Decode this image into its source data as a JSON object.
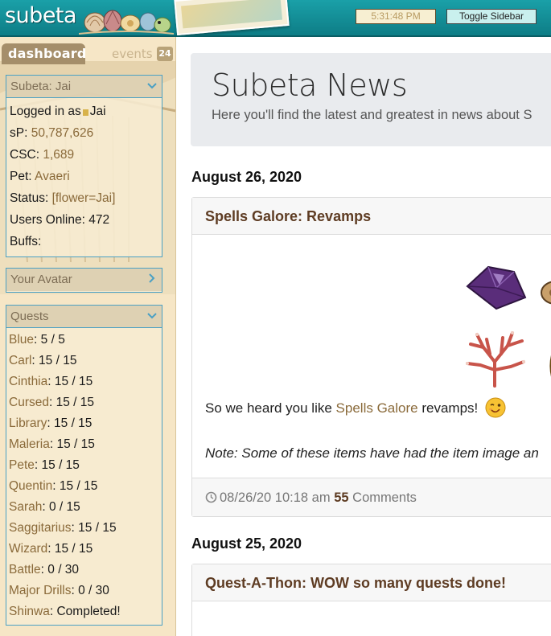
{
  "header": {
    "logo_text": "subeta",
    "clock": "5:31:48 PM",
    "toggle_sidebar_label": "Toggle Sidebar"
  },
  "sidebar": {
    "tabs": {
      "dashboard": "dashboard",
      "events": "events",
      "events_count": "24"
    },
    "user_panel": {
      "title": "Subeta: Jai",
      "logged_in_label": "Logged in as",
      "username": "Jai",
      "sp_label": "sP:",
      "sp_value": "50,787,626",
      "csc_label": "CSC:",
      "csc_value": "1,689",
      "pet_label": "Pet:",
      "pet_value": "Avaeri",
      "status_label": "Status:",
      "status_value": "[flower=Jai]",
      "users_online_label": "Users Online:",
      "users_online_value": "472",
      "buffs_label": "Buffs:"
    },
    "avatar_panel": {
      "title": "Your Avatar"
    },
    "quests_panel": {
      "title": "Quests",
      "items": [
        {
          "name": "Blue",
          "progress": "5 / 5"
        },
        {
          "name": "Carl",
          "progress": "15 / 15"
        },
        {
          "name": "Cinthia",
          "progress": "15 / 15"
        },
        {
          "name": "Cursed",
          "progress": "15 / 15"
        },
        {
          "name": "Library",
          "progress": "15 / 15"
        },
        {
          "name": "Maleria",
          "progress": "15 / 15"
        },
        {
          "name": "Pete",
          "progress": "15 / 15"
        },
        {
          "name": "Quentin",
          "progress": "15 / 15"
        },
        {
          "name": "Sarah",
          "progress": "0 / 15"
        },
        {
          "name": "Saggitarius",
          "progress": "15 / 15"
        },
        {
          "name": "Wizard",
          "progress": "15 / 15"
        },
        {
          "name": "Battle",
          "progress": "0 / 30"
        },
        {
          "name": "Major Drills",
          "progress": "0 / 30"
        },
        {
          "name": "Shinwa",
          "progress": "Completed!"
        }
      ]
    }
  },
  "main": {
    "title": "Subeta News",
    "subtitle": "Here you'll find the latest and greatest in news about S",
    "posts": [
      {
        "date": "August 26, 2020",
        "title": "Spells Galore: Revamps",
        "body_prefix": "So we heard you like ",
        "body_link": "Spells Galore",
        "body_suffix": " revamps!",
        "note": "Note: Some of these items have had the item image an",
        "timestamp": "08/26/20 10:18 am",
        "comment_count": "55",
        "comments_label": "Comments"
      },
      {
        "date": "August 25, 2020",
        "title": "Quest-A-Thon: WOW so many quests done!"
      }
    ]
  }
}
